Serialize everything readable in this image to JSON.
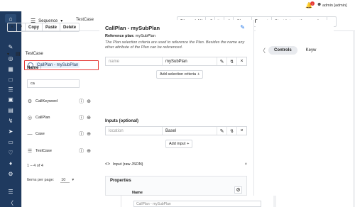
{
  "topbar": {
    "bell_badge": "!",
    "user": "admin [admin]"
  },
  "toolbar": {
    "sequence_label": "Sequence",
    "testcase_name": "TestCase",
    "discard_all": "Discard All",
    "clone": "Clone",
    "export": "Export",
    "start_session": "Start interactive session"
  },
  "tree": {
    "copy": "Copy",
    "paste": "Paste",
    "delete": "Delete",
    "root_label": "TestCase",
    "child_label": "CallPlan - mySubPlan"
  },
  "plan": {
    "title": "CallPlan - mySubPlan",
    "ref_key": "Reference plan:",
    "ref_value": "mySubPlan",
    "description": "The Plan selection criteria are used to reference the Plan. Besides the name any other attribute of the Plan can be referenced.",
    "criteria_key": "name",
    "criteria_value": "mySubPlan",
    "add_criteria": "Add selection criteria",
    "inputs_title": "Inputs (optional)",
    "input_key": "location",
    "input_value": "Basel",
    "add_input": "Add input",
    "json_label": "Input (raw JSON)",
    "properties_title": "Properties",
    "name_label": "Name",
    "name_value": "CallPlan - mySubPlan"
  },
  "controls": {
    "tab_active": "Controls",
    "tab_other": "Keyw",
    "name_header": "Name",
    "search_value": "ca",
    "items": [
      "CallKeyword",
      "CallPlan",
      "Case",
      "TestCase"
    ],
    "pager": "1 – 4 of 4",
    "items_per_page_label": "Items per page:",
    "items_per_page_value": "10"
  },
  "colors": {
    "nav": "#1f3a5f",
    "accent": "#1a73e8",
    "highlight": "#e53935"
  }
}
